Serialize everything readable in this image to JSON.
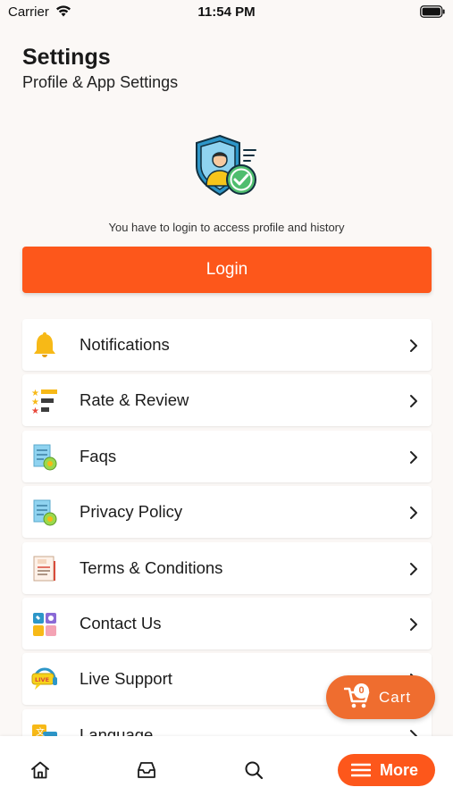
{
  "status_bar": {
    "carrier": "Carrier",
    "time": "11:54 PM",
    "wifi_icon": "wifi-icon",
    "battery_icon": "battery-full-icon"
  },
  "header": {
    "title": "Settings",
    "subtitle": "Profile & App Settings"
  },
  "login_section": {
    "illustration": "secure-user-shield-icon",
    "hint": "You have to login to access profile and history",
    "button_label": "Login"
  },
  "menu": {
    "items": [
      {
        "label": "Notifications",
        "icon": "bell-icon"
      },
      {
        "label": "Rate & Review",
        "icon": "rating-stars-icon"
      },
      {
        "label": "Faqs",
        "icon": "faq-document-icon"
      },
      {
        "label": "Privacy Policy",
        "icon": "privacy-document-icon"
      },
      {
        "label": "Terms & Conditions",
        "icon": "terms-document-icon"
      },
      {
        "label": "Contact Us",
        "icon": "contact-icon"
      },
      {
        "label": "Live Support",
        "icon": "live-support-icon"
      },
      {
        "label": "Language",
        "icon": "language-icon"
      }
    ]
  },
  "cart": {
    "count": "0",
    "label": "Cart",
    "icon": "cart-icon"
  },
  "bottom_nav": {
    "home_icon": "home-icon",
    "orders_icon": "inbox-icon",
    "search_icon": "search-icon",
    "more_label": "More",
    "more_icon": "menu-icon"
  },
  "colors": {
    "accent": "#fd571b",
    "cart_fab": "#ef6d2f",
    "background": "#fbf8f6",
    "card": "#ffffff"
  }
}
